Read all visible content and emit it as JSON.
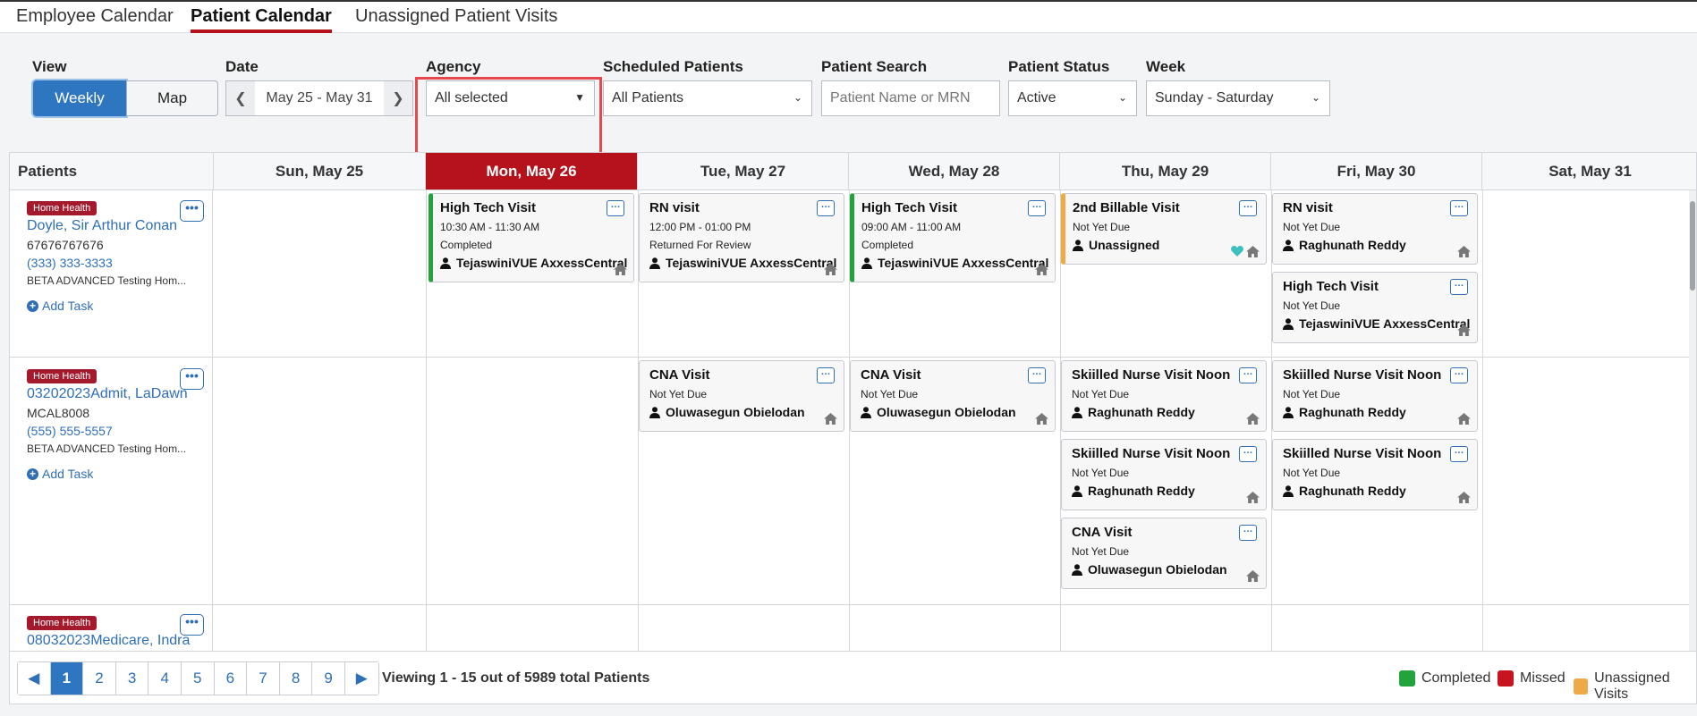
{
  "tabs": [
    "Employee Calendar",
    "Patient Calendar",
    "Unassigned Patient Visits"
  ],
  "filters": {
    "view": {
      "label": "View",
      "options": [
        "Weekly",
        "Map"
      ],
      "selected": "Weekly"
    },
    "date": {
      "label": "Date",
      "value": "May 25 - May 31"
    },
    "agency": {
      "label": "Agency",
      "value": "All selected"
    },
    "scheduled": {
      "label": "Scheduled Patients",
      "value": "All Patients"
    },
    "search": {
      "label": "Patient Search",
      "placeholder": "Patient Name or MRN"
    },
    "status": {
      "label": "Patient Status",
      "value": "Active"
    },
    "week": {
      "label": "Week",
      "value": "Sunday - Saturday"
    }
  },
  "calendar": {
    "patients_header": "Patients",
    "days": [
      "Sun, May 25",
      "Mon, May 26",
      "Tue, May 27",
      "Wed, May 28",
      "Thu, May 29",
      "Fri, May 30",
      "Sat, May 31"
    ],
    "today": "Mon, May 26",
    "patients": [
      {
        "badge": "Home Health",
        "name": "Doyle, Sir Arthur Conan",
        "mrn": "67676767676",
        "phone": "(333) 333-3333",
        "agency": "BETA ADVANCED Testing Hom...",
        "add_task": "Add Task"
      },
      {
        "badge": "Home Health",
        "name": "03202023Admit, LaDawn",
        "mrn": "MCAL8008",
        "phone": "(555) 555-5557",
        "agency": "BETA ADVANCED Testing Hom...",
        "add_task": "Add Task"
      },
      {
        "badge": "Home Health",
        "name": "08032023Medicare, Indra"
      }
    ],
    "visits": {
      "r0_mon": {
        "title": "High Tech Visit",
        "time": "10:30 AM - 11:30 AM",
        "status": "Completed",
        "employee": "TejaswiniVUE AxxessCentral"
      },
      "r0_tue": {
        "title": "RN visit",
        "time": "12:00 PM - 01:00 PM",
        "status": "Returned For Review",
        "employee": "TejaswiniVUE AxxessCentral"
      },
      "r0_wed": {
        "title": "High Tech Visit",
        "time": "09:00 AM - 11:00 AM",
        "status": "Completed",
        "employee": "TejaswiniVUE AxxessCentral"
      },
      "r0_thu": {
        "title": "2nd Billable Visit",
        "status": "Not Yet Due",
        "employee": "Unassigned"
      },
      "r0_fri_a": {
        "title": "RN visit",
        "status": "Not Yet Due",
        "employee": "Raghunath Reddy"
      },
      "r0_fri_b": {
        "title": "High Tech Visit",
        "status": "Not Yet Due",
        "employee": "TejaswiniVUE AxxessCentral"
      },
      "r1_tue": {
        "title": "CNA Visit",
        "status": "Not Yet Due",
        "employee": "Oluwasegun Obielodan"
      },
      "r1_wed": {
        "title": "CNA Visit",
        "status": "Not Yet Due",
        "employee": "Oluwasegun Obielodan"
      },
      "r1_thu_a": {
        "title": "Skiilled Nurse Visit Noon",
        "status": "Not Yet Due",
        "employee": "Raghunath Reddy"
      },
      "r1_thu_b": {
        "title": "Skiilled Nurse Visit Noon",
        "status": "Not Yet Due",
        "employee": "Raghunath Reddy"
      },
      "r1_thu_c": {
        "title": "CNA Visit",
        "status": "Not Yet Due",
        "employee": "Oluwasegun Obielodan"
      },
      "r1_fri_a": {
        "title": "Skiilled Nurse Visit Noon",
        "status": "Not Yet Due",
        "employee": "Raghunath Reddy"
      },
      "r1_fri_b": {
        "title": "Skiilled Nurse Visit Noon",
        "status": "Not Yet Due",
        "employee": "Raghunath Reddy"
      }
    }
  },
  "pagination": {
    "pages": [
      "1",
      "2",
      "3",
      "4",
      "5",
      "6",
      "7",
      "8",
      "9"
    ],
    "current": "1",
    "viewing": "Viewing 1 - 15 out of 5989 total Patients"
  },
  "legend": [
    {
      "label": "Completed",
      "color": "#22a33b"
    },
    {
      "label": "Missed",
      "color": "#c8141e"
    },
    {
      "label": "Unassigned Visits",
      "color": "#f0a948"
    }
  ],
  "colors": {
    "brand_red": "#b5121b",
    "primary_blue": "#2f76c1",
    "link_blue": "#2f6fb6",
    "highlight": "#e5484d"
  },
  "icons": [
    "person-icon",
    "home-icon",
    "heart-icon",
    "more-icon",
    "plus-circle-icon",
    "caret-down-icon",
    "chevron-left-icon",
    "chevron-right-icon"
  ]
}
